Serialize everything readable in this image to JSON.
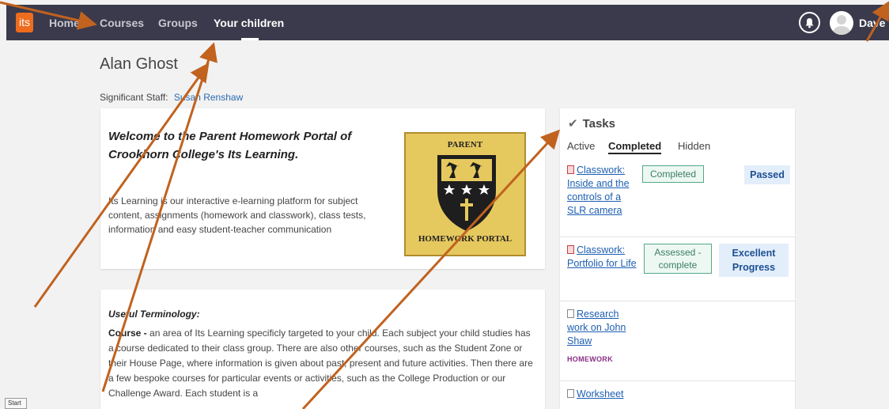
{
  "nav": {
    "logo_text": "its",
    "items": [
      {
        "label": "Home"
      },
      {
        "label": "Courses"
      },
      {
        "label": "Groups"
      },
      {
        "label": "Your children"
      }
    ],
    "user_name": "Dave"
  },
  "student": {
    "name": "Alan Ghost",
    "staff_label": "Significant Staff:",
    "staff_name": "Susan Renshaw"
  },
  "welcome": {
    "title": "Welcome to the Parent Homework Portal of Crookhorn College's Its Learning.",
    "text": "Its Learning is our interactive e-learning platform for subject content, assignments (homework and classwork), class tests, information and easy student-teacher communication",
    "logo_top": "PARENT",
    "logo_bottom": "HOMEWORK PORTAL"
  },
  "terms": {
    "title": "Useful Terminology:",
    "term": "Course - ",
    "text": "an area of Its Learning specificly targeted to your child.  Each subject your child studies has a course dedicated to their class group.  There are also other courses, such as the Student Zone or their House Page, where information is given about past, present and future activities.  Then there are a few bespoke courses for particular events or activities, such as the College Production or our Challenge Award.  Each student is a"
  },
  "tasks": {
    "title": "Tasks",
    "tabs": [
      {
        "label": "Active"
      },
      {
        "label": "Completed"
      },
      {
        "label": "Hidden"
      }
    ],
    "items": [
      {
        "title": "Classwork: Inside and the controls of a SLR camera",
        "status": "Completed",
        "result": "Passed"
      },
      {
        "title": "Classwork: Portfolio for Life",
        "status": "Assessed - complete",
        "result": "Excellent Progress"
      },
      {
        "title": "Research work on John Shaw",
        "tag": "HOMEWORK"
      },
      {
        "title": "Worksheet"
      }
    ]
  },
  "footer": {
    "start_label": "Start"
  },
  "colors": {
    "topbar": "#3a3a4c",
    "accent": "#ee6c1e",
    "link": "#1d5fb1",
    "annotation_arrow": "#c1621f"
  }
}
